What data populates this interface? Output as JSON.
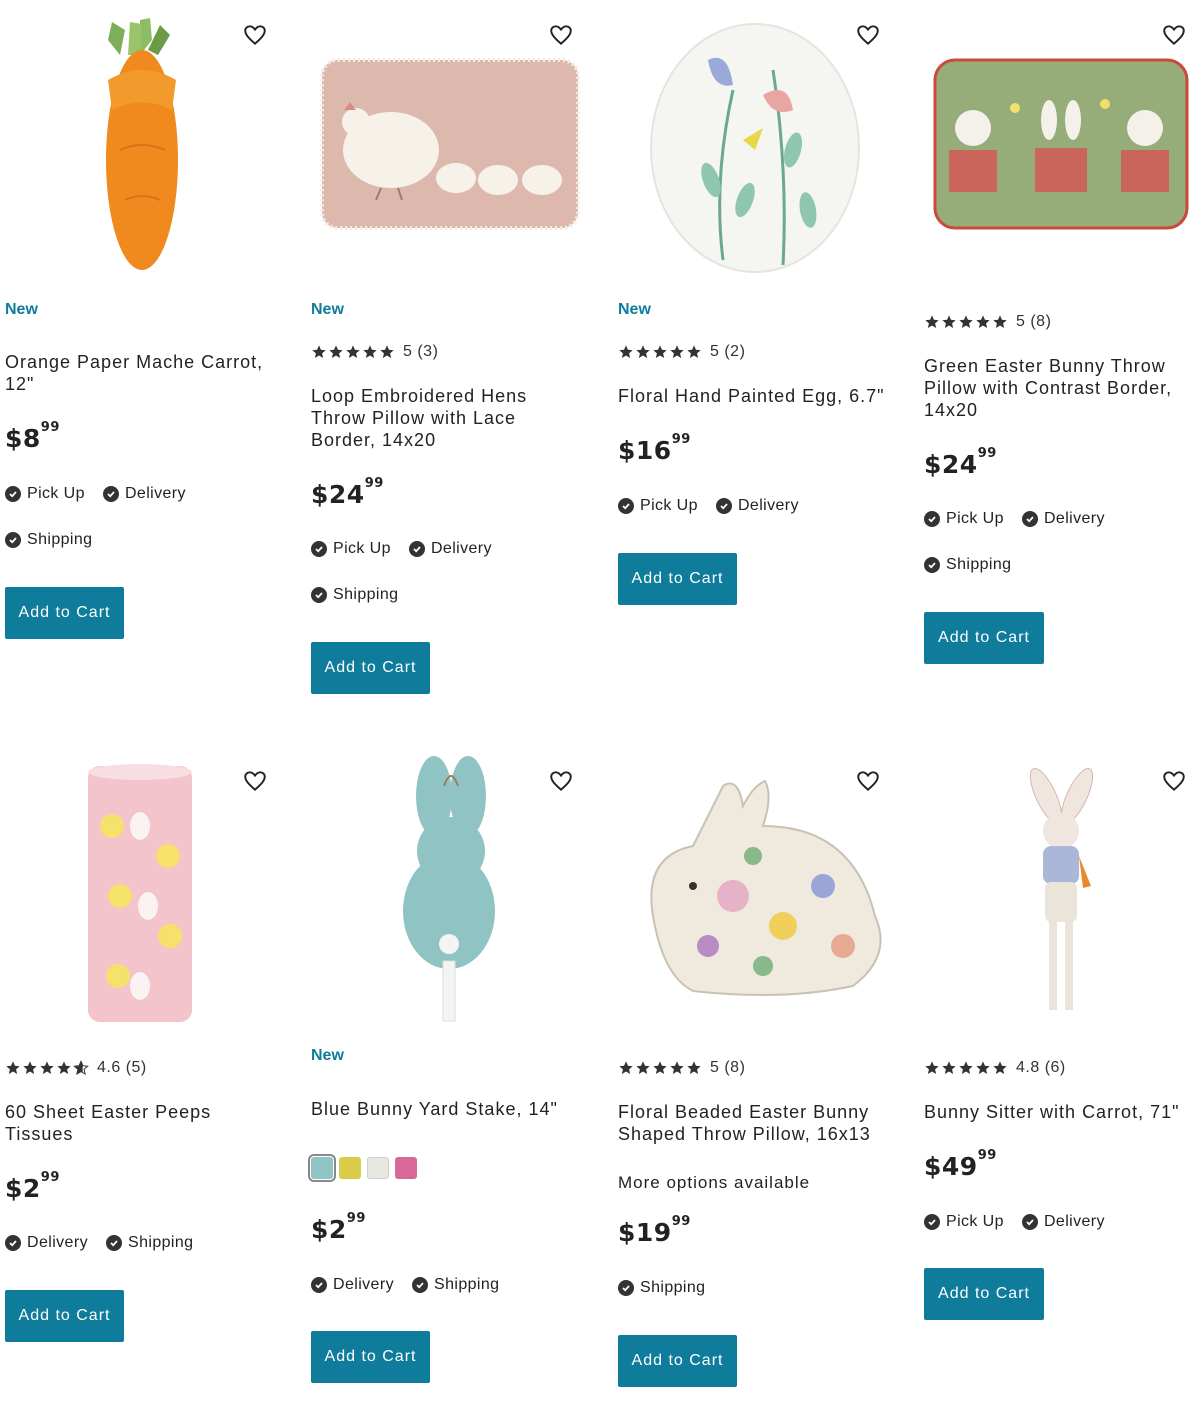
{
  "products": [
    {
      "new_label": "New",
      "title": "Orange Paper Mache Carrot, 12\"",
      "price_dollars": "$8",
      "price_cents": "99",
      "fulfillment": [
        "Pick Up",
        "Delivery",
        "Shipping"
      ],
      "add_label": "Add to Cart",
      "image": "orange-carrot-image"
    },
    {
      "new_label": "New",
      "rating_text": "5 (3)",
      "rating_value": 5,
      "title": "Loop Embroidered Hens Throw Pillow with Lace Border, 14x20",
      "price_dollars": "$24",
      "price_cents": "99",
      "fulfillment": [
        "Pick Up",
        "Delivery",
        "Shipping"
      ],
      "add_label": "Add to Cart",
      "image": "hens-pillow-image"
    },
    {
      "new_label": "New",
      "rating_text": "5 (2)",
      "rating_value": 5,
      "title": "Floral Hand Painted Egg, 6.7\"",
      "price_dollars": "$16",
      "price_cents": "99",
      "fulfillment": [
        "Pick Up",
        "Delivery"
      ],
      "add_label": "Add to Cart",
      "image": "floral-egg-image"
    },
    {
      "rating_text": "5 (8)",
      "rating_value": 5,
      "title": "Green Easter Bunny Throw Pillow with Contrast Border, 14x20",
      "price_dollars": "$24",
      "price_cents": "99",
      "fulfillment": [
        "Pick Up",
        "Delivery",
        "Shipping"
      ],
      "add_label": "Add to Cart",
      "image": "green-bunny-pillow-image"
    },
    {
      "rating_text": "4.6 (5)",
      "rating_value": 4.6,
      "title": "60 Sheet Easter Peeps Tissues",
      "price_dollars": "$2",
      "price_cents": "99",
      "fulfillment": [
        "Delivery",
        "Shipping"
      ],
      "add_label": "Add to Cart",
      "image": "peeps-tissues-image"
    },
    {
      "new_label": "New",
      "title": "Blue Bunny Yard Stake, 14\"",
      "swatches": [
        "#8fc3c4",
        "#d8cc4a",
        "#e9e7e1",
        "#d9679a"
      ],
      "price_dollars": "$2",
      "price_cents": "99",
      "fulfillment": [
        "Delivery",
        "Shipping"
      ],
      "add_label": "Add to Cart",
      "image": "blue-bunny-stake-image"
    },
    {
      "rating_text": "5 (8)",
      "rating_value": 5,
      "title": "Floral Beaded Easter Bunny Shaped Throw Pillow, 16x13",
      "more_options": "More options available",
      "price_dollars": "$19",
      "price_cents": "99",
      "fulfillment": [
        "Shipping"
      ],
      "add_label": "Add to Cart",
      "image": "floral-bunny-pillow-image"
    },
    {
      "rating_text": "4.8 (6)",
      "rating_value": 4.8,
      "title": "Bunny Sitter with Carrot, 71\"",
      "price_dollars": "$49",
      "price_cents": "99",
      "fulfillment": [
        "Pick Up",
        "Delivery"
      ],
      "add_label": "Add to Cart",
      "image": "bunny-sitter-image"
    }
  ],
  "theme": {
    "accent": "#0e7c9a",
    "text": "#222222"
  }
}
